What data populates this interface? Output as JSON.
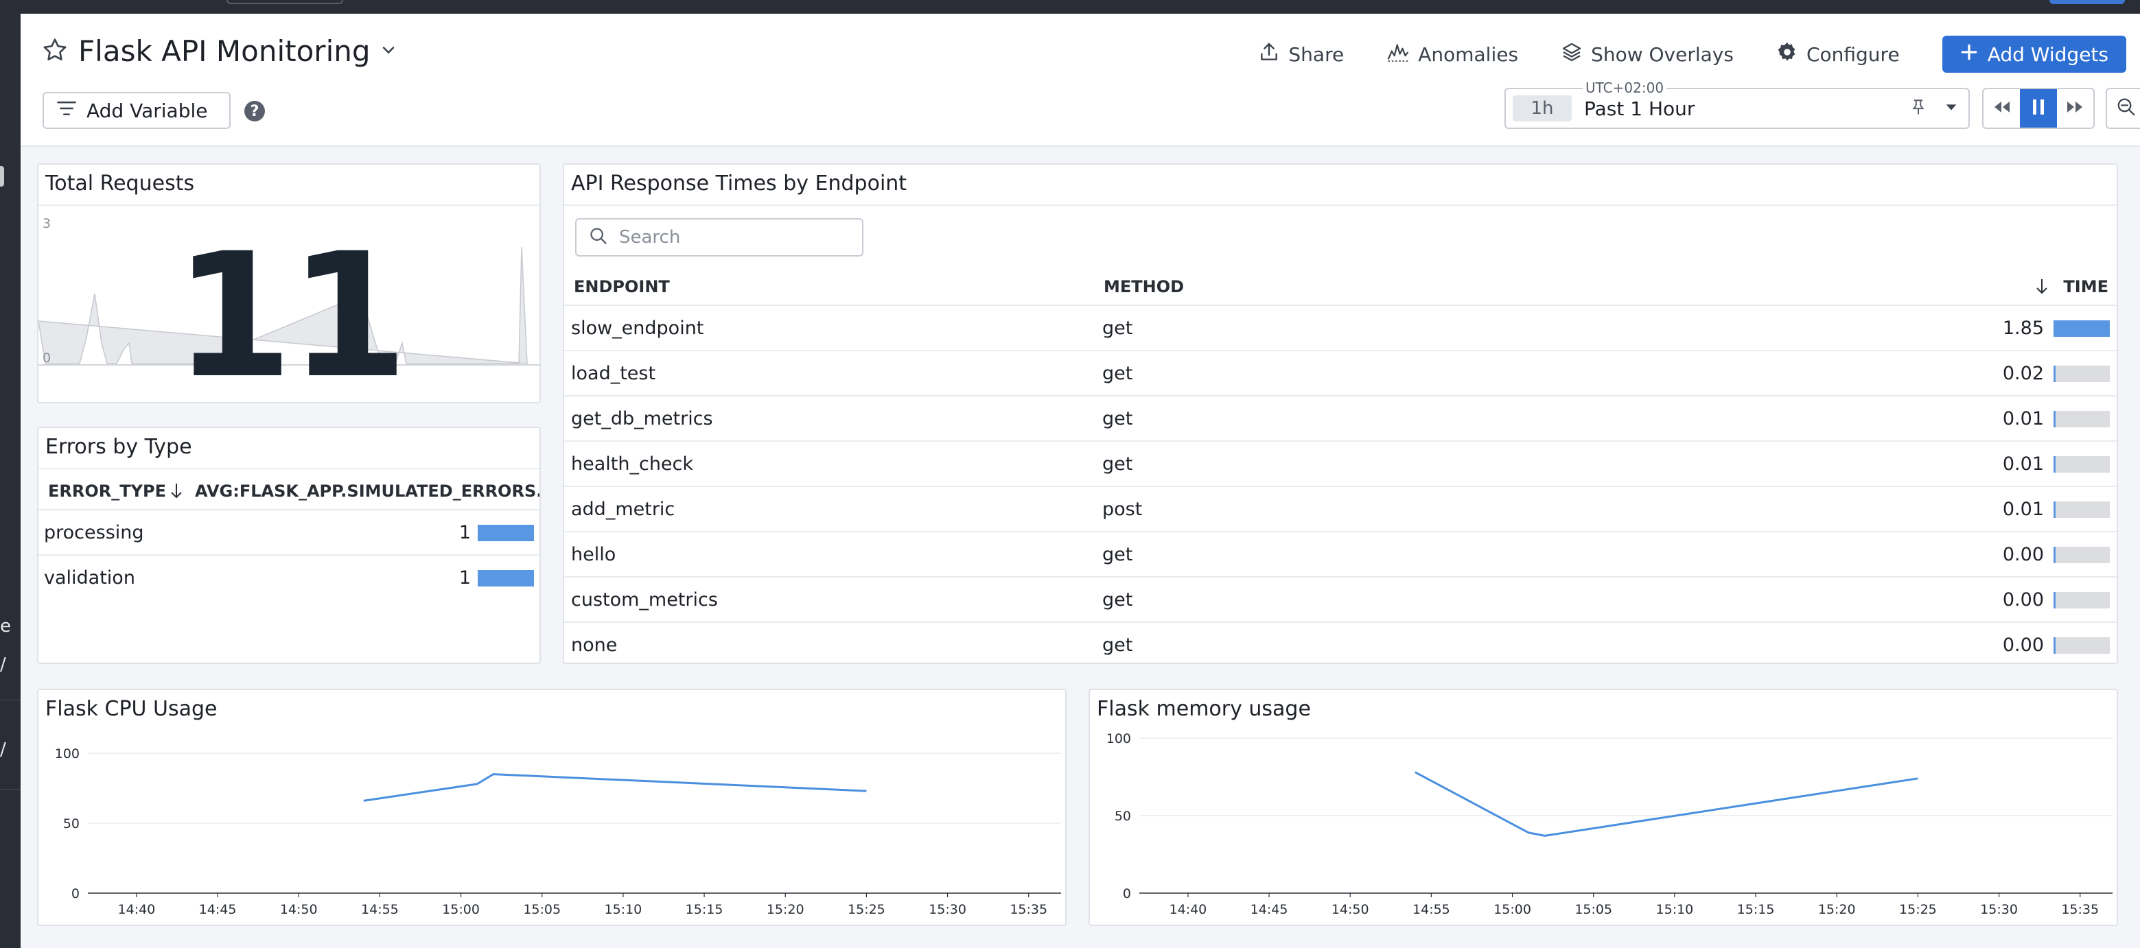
{
  "dashboard": {
    "title": "Flask API Monitoring",
    "actions": {
      "share": "Share",
      "anomalies": "Anomalies",
      "show_overlays": "Show Overlays",
      "configure": "Configure",
      "add_widgets": "Add Widgets"
    },
    "add_variable": "Add Variable",
    "timezone": "UTC+02:00",
    "time_chip": "1h",
    "time_label": "Past 1 Hour"
  },
  "total_requests": {
    "title": "Total Requests",
    "value": "11",
    "axis_max": "3",
    "axis_min": "0"
  },
  "errors": {
    "title": "Errors by Type",
    "col1": "ERROR_TYPE",
    "col2": "AVG:FLASK_APP.SIMULATED_ERRORS.CO...",
    "rows": [
      {
        "type": "processing",
        "value": "1",
        "fill": 1.0
      },
      {
        "type": "validation",
        "value": "1",
        "fill": 1.0
      }
    ]
  },
  "response_times": {
    "title": "API Response Times by Endpoint",
    "search_placeholder": "Search",
    "col_endpoint": "ENDPOINT",
    "col_method": "METHOD",
    "col_time": "TIME",
    "rows": [
      {
        "endpoint": "slow_endpoint",
        "method": "get",
        "time": "1.85",
        "fill": 1.0
      },
      {
        "endpoint": "load_test",
        "method": "get",
        "time": "0.02",
        "fill": 0.02
      },
      {
        "endpoint": "get_db_metrics",
        "method": "get",
        "time": "0.01",
        "fill": 0.01
      },
      {
        "endpoint": "health_check",
        "method": "get",
        "time": "0.01",
        "fill": 0.01
      },
      {
        "endpoint": "add_metric",
        "method": "post",
        "time": "0.01",
        "fill": 0.01
      },
      {
        "endpoint": "hello",
        "method": "get",
        "time": "0.00",
        "fill": 0.0
      },
      {
        "endpoint": "custom_metrics",
        "method": "get",
        "time": "0.00",
        "fill": 0.0
      },
      {
        "endpoint": "none",
        "method": "get",
        "time": "0.00",
        "fill": 0.0
      }
    ]
  },
  "colors": {
    "accent": "#2e6fd4",
    "series": "#4a8fe0",
    "bar": "#5a97e3",
    "bar_bg": "#dcdde0"
  },
  "chart_data": [
    {
      "type": "line",
      "title": "Flask CPU Usage",
      "x": [
        "14:54",
        "15:01",
        "15:02",
        "15:25"
      ],
      "y": [
        66,
        78,
        85,
        73
      ],
      "xticks": [
        "14:40",
        "14:45",
        "14:50",
        "14:55",
        "15:00",
        "15:05",
        "15:10",
        "15:15",
        "15:20",
        "15:25",
        "15:30",
        "15:35"
      ],
      "yticks": [
        0,
        50,
        100
      ],
      "ylim": [
        0,
        100
      ],
      "xlim": [
        "14:37",
        "15:37"
      ],
      "grid": true
    },
    {
      "type": "line",
      "title": "Flask memory usage",
      "x": [
        "14:54",
        "15:01",
        "15:02",
        "15:25"
      ],
      "y": [
        78,
        39,
        37,
        74
      ],
      "xticks": [
        "14:40",
        "14:45",
        "14:50",
        "14:55",
        "15:00",
        "15:05",
        "15:10",
        "15:15",
        "15:20",
        "15:25",
        "15:30",
        "15:35"
      ],
      "yticks": [
        0,
        50,
        100
      ],
      "ylim": [
        0,
        100
      ],
      "xlim": [
        "14:37",
        "15:37"
      ],
      "grid": true
    }
  ]
}
